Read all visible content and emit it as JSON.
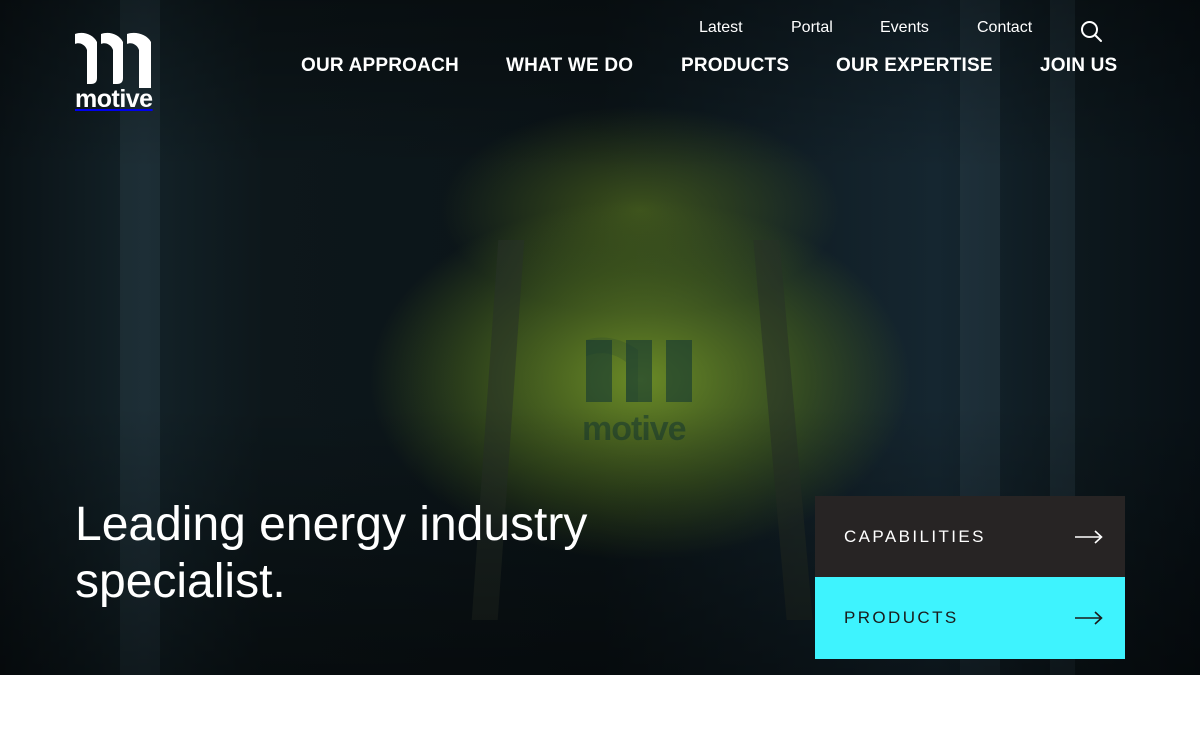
{
  "brand": {
    "name": "motive",
    "accent_color": "#3ef3fe",
    "dark_color": "#272424"
  },
  "utility_nav": [
    {
      "label": "Latest"
    },
    {
      "label": "Portal"
    },
    {
      "label": "Events"
    },
    {
      "label": "Contact"
    }
  ],
  "search": {
    "icon": "search-icon"
  },
  "main_nav": [
    {
      "label": "OUR APPROACH"
    },
    {
      "label": "WHAT WE DO"
    },
    {
      "label": "PRODUCTS"
    },
    {
      "label": "OUR EXPERTISE"
    },
    {
      "label": "JOIN US"
    }
  ],
  "hero": {
    "headline": "Leading energy industry specialist.",
    "jacket_text": "motive"
  },
  "cta": [
    {
      "label": "CAPABILITIES",
      "icon": "arrow-right-icon"
    },
    {
      "label": "PRODUCTS",
      "icon": "arrow-right-icon"
    }
  ]
}
